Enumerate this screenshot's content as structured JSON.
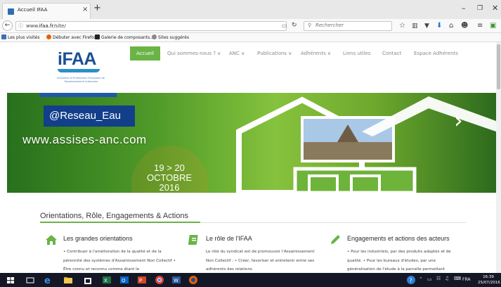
{
  "browser": {
    "tab_title": "Accueil IFAA",
    "tab_close": "×",
    "new_tab": "+",
    "url_prefix": "www.",
    "url_domain": "ifaa.fr",
    "url_path": "/site/",
    "search_placeholder": "Rechercher",
    "bookmarks": [
      "Les plus visités",
      "Débuter avec Firefox",
      "Galerie de composants...",
      "Sites suggérés"
    ]
  },
  "site": {
    "logo_text": "iFAA",
    "logo_subtitle": "Industries et Entreprises Françaises de l'Assainissement Autonome",
    "nav": [
      "Accueil",
      "Qui sommes-nous ? ∨",
      "ANC ∨",
      "Publications ∨",
      "Adhérents ∨",
      "Liens utiles",
      "Contact",
      "Espace Adhérents"
    ],
    "banner": {
      "tag": "@Reseau_Eau",
      "url": "www.assises-anc.com",
      "date_line1": "19 > 20",
      "date_line2": "OCTOBRE",
      "date_line3": "2016"
    },
    "section_title": "Orientations, Rôle, Engagements & Actions",
    "columns": [
      {
        "title": "Les grandes orientations",
        "text": "• Contribuer à l'amélioration de la qualité et de la pérennité des systèmes d'Assainissement Non Collectif • Être connu et reconnu comme étant le"
      },
      {
        "title": "Le rôle de l'IFAA",
        "text": "Le rôle du syndicat est de promouvoir l'Assainissement Non Collectif : • Créer, favoriser et entretenir entre ses adhérents des relations"
      },
      {
        "title": "Engagements et actions des acteurs",
        "text": "• Pour les industriels, par des produits adaptés et de qualité. • Pour les bureaux d'études, par une généralisation de l'étude à la parcelle permettant"
      }
    ]
  },
  "taskbar": {
    "lang": "FRA",
    "time": "16:39",
    "date": "25/07/2016"
  },
  "colors": {
    "accent_green": "#6ab446",
    "brand_blue": "#1d4f93",
    "taskbar": "#141826"
  }
}
